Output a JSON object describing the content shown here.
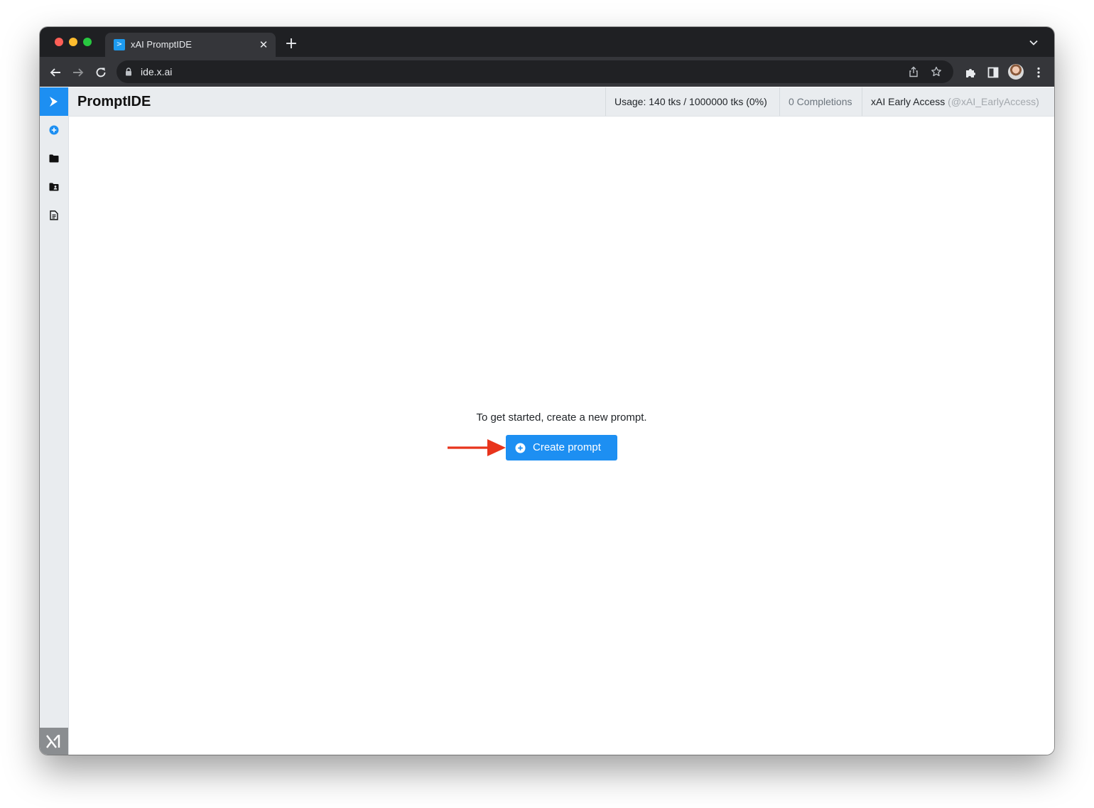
{
  "browser": {
    "tab_title": "xAI PromptIDE",
    "favicon_glyph": ">",
    "url": "ide.x.ai"
  },
  "header": {
    "title": "PromptIDE",
    "usage": "Usage: 140 tks / 1000000 tks (0%)",
    "completions": "0 Completions",
    "user_name": "xAI Early Access",
    "user_handle": "(@xAI_EarlyAccess)"
  },
  "main": {
    "empty_message": "To get started, create a new prompt.",
    "create_button_label": "Create prompt"
  },
  "sidebar": {
    "items": [
      {
        "icon": "add-circle-icon"
      },
      {
        "icon": "folder-icon"
      },
      {
        "icon": "shared-folder-icon"
      },
      {
        "icon": "document-icon"
      }
    ]
  },
  "colors": {
    "accent": "#1d8ff2",
    "sidebar_bg": "#e9ecef",
    "annotation_arrow": "#e8341c"
  }
}
